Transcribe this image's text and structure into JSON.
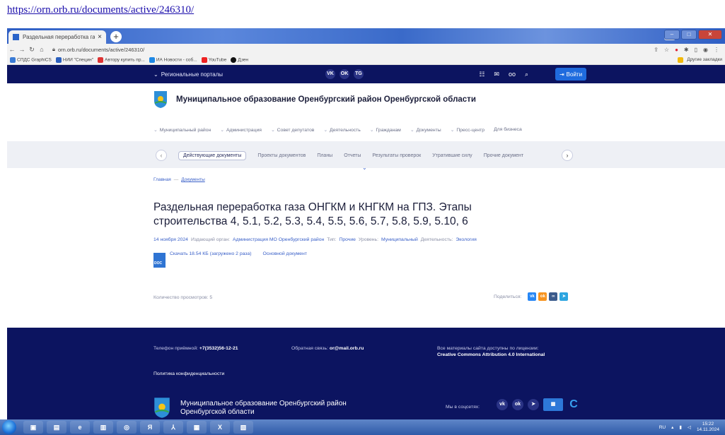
{
  "caption_url": "https://orn.orb.ru/documents/active/246310/",
  "browser": {
    "tab_title": "Раздельная переработка газа О",
    "tab_close": "×",
    "new_tab": "+",
    "address": "orn.orb.ru/documents/active/246310/",
    "bookmarks": [
      "СПДС GraphiCS",
      "НИИ \"Специн\"",
      "Автору купить пр...",
      "ИА Новости - соб...",
      "YouTube",
      "Дзен"
    ],
    "bookmarks_other": "Другие закладки"
  },
  "site": {
    "portals_label": "Региональные порталы",
    "login_label": "Войти",
    "top_socials": [
      "VK",
      "OK",
      "TG"
    ],
    "name": "Муниципальное образование Оренбургский район Оренбургской области",
    "nav": [
      "Муниципальный район",
      "Администрация",
      "Совет депутатов",
      "Деятельность",
      "Гражданам",
      "Документы",
      "Пресс-центр",
      "Для бизнеса"
    ],
    "doc_tabs": [
      "Действующие документы",
      "Проекты документов",
      "Планы",
      "Отчеты",
      "Результаты проверок",
      "Утратившие силу",
      "Прочие документ"
    ]
  },
  "breadcrumb": {
    "home": "Главная",
    "sep": "—",
    "current": "Документы"
  },
  "document": {
    "title": "Раздельная переработка газа ОНГКМ и КНГКМ на ГПЗ. Этапы строительства 4, 5.1, 5.2, 5.3, 5.4, 5.5, 5.6, 5.7, 5.8, 5.9, 5.10, 6",
    "date": "14 ноября 2024",
    "issuer_label": "Издающий орган:",
    "issuer": "Администрация МО Оренбургский район",
    "type_label": "Тип:",
    "type": "Прочие",
    "level_label": "Уровень:",
    "level": "Муниципальный",
    "activity_label": "Деятельность:",
    "activity": "Экология",
    "file_ext": "DOC",
    "download_text": "Скачать 18.54 КБ (загружено 2 раза)",
    "main_doc": "Основной документ",
    "views": "Количество просмотров: 5",
    "share_label": "Поделиться:"
  },
  "footer": {
    "phone_label": "Телефон приёмной:",
    "phone": "+7(3532)56-12-21",
    "mail_label": "Обратная связь:",
    "mail": "or@mail.orb.ru",
    "license_line1": "Все материалы сайта доступны по лицензии:",
    "license_line2": "Creative Commons Attribution 4.0 International",
    "privacy": "Политика конфиденциальности",
    "brand_name": "Муниципальное образование Оренбургский район Оренбургской области",
    "social_label": "Мы в соцсетях:"
  },
  "taskbar": {
    "lang": "RU",
    "time": "15:22",
    "date": "14.11.2024"
  },
  "colors": {
    "dark_navy": "#0c1460",
    "link_blue": "#3a60c8",
    "button_blue": "#1f6bde"
  }
}
